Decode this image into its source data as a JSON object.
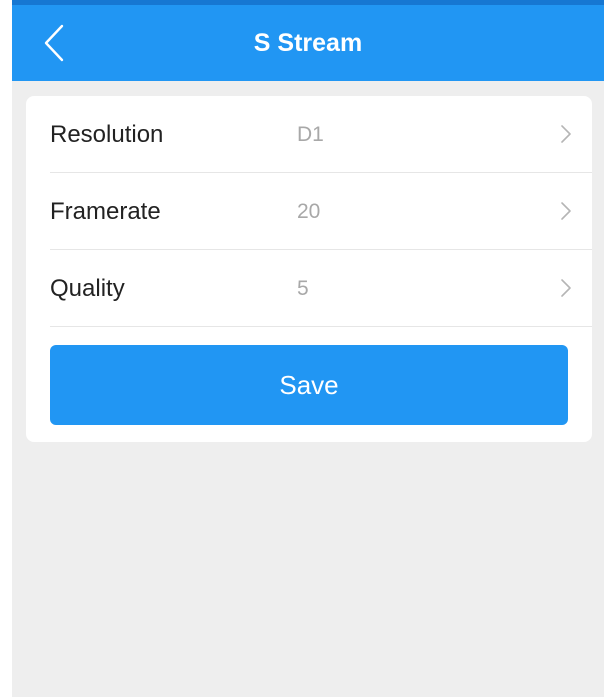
{
  "header": {
    "title": "S Stream",
    "back_icon": "chevron-left-icon"
  },
  "settings": {
    "rows": [
      {
        "label": "Resolution",
        "value": "D1",
        "icon": "chevron-right-icon"
      },
      {
        "label": "Framerate",
        "value": "20",
        "icon": "chevron-right-icon"
      },
      {
        "label": "Quality",
        "value": "5",
        "icon": "chevron-right-icon"
      }
    ]
  },
  "actions": {
    "save_label": "Save"
  },
  "colors": {
    "accent": "#2196f3",
    "background": "#eeeeee",
    "card": "#ffffff"
  }
}
